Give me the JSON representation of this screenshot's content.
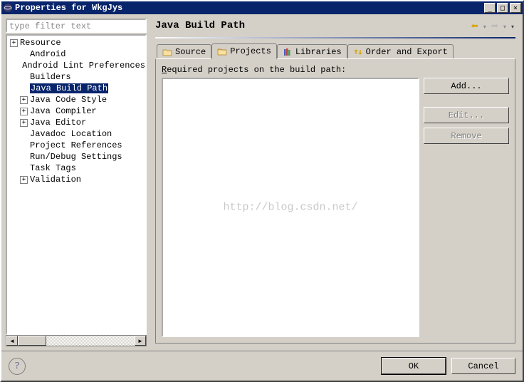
{
  "window": {
    "title": "Properties for WkgJys"
  },
  "filter": {
    "placeholder": "type filter text"
  },
  "tree": {
    "items": [
      {
        "label": "Resource",
        "expandable": true,
        "sign": "+",
        "depth": 0
      },
      {
        "label": "Android",
        "expandable": false,
        "depth": 1
      },
      {
        "label": "Android Lint Preferences",
        "expandable": false,
        "depth": 1
      },
      {
        "label": "Builders",
        "expandable": false,
        "depth": 1
      },
      {
        "label": "Java Build Path",
        "expandable": false,
        "depth": 1,
        "selected": true
      },
      {
        "label": "Java Code Style",
        "expandable": true,
        "sign": "+",
        "depth": 1
      },
      {
        "label": "Java Compiler",
        "expandable": true,
        "sign": "+",
        "depth": 1
      },
      {
        "label": "Java Editor",
        "expandable": true,
        "sign": "+",
        "depth": 1
      },
      {
        "label": "Javadoc Location",
        "expandable": false,
        "depth": 1
      },
      {
        "label": "Project References",
        "expandable": false,
        "depth": 1
      },
      {
        "label": "Run/Debug Settings",
        "expandable": false,
        "depth": 1
      },
      {
        "label": "Task Tags",
        "expandable": false,
        "depth": 1
      },
      {
        "label": "Validation",
        "expandable": true,
        "sign": "+",
        "depth": 1
      }
    ]
  },
  "page": {
    "title": "Java Build Path",
    "tabs": [
      {
        "label": "Source",
        "icon": "folder-source-icon"
      },
      {
        "label": "Projects",
        "icon": "folder-projects-icon",
        "active": true
      },
      {
        "label": "Libraries",
        "icon": "libraries-icon"
      },
      {
        "label": "Order and Export",
        "icon": "order-export-icon"
      }
    ],
    "required_label_prefix": "R",
    "required_label_rest": "equired projects on the build path:",
    "buttons": {
      "add": "Add...",
      "edit": "Edit...",
      "remove": "Remove"
    },
    "watermark": "http://blog.csdn.net/"
  },
  "footer": {
    "ok": "OK",
    "cancel": "Cancel"
  }
}
